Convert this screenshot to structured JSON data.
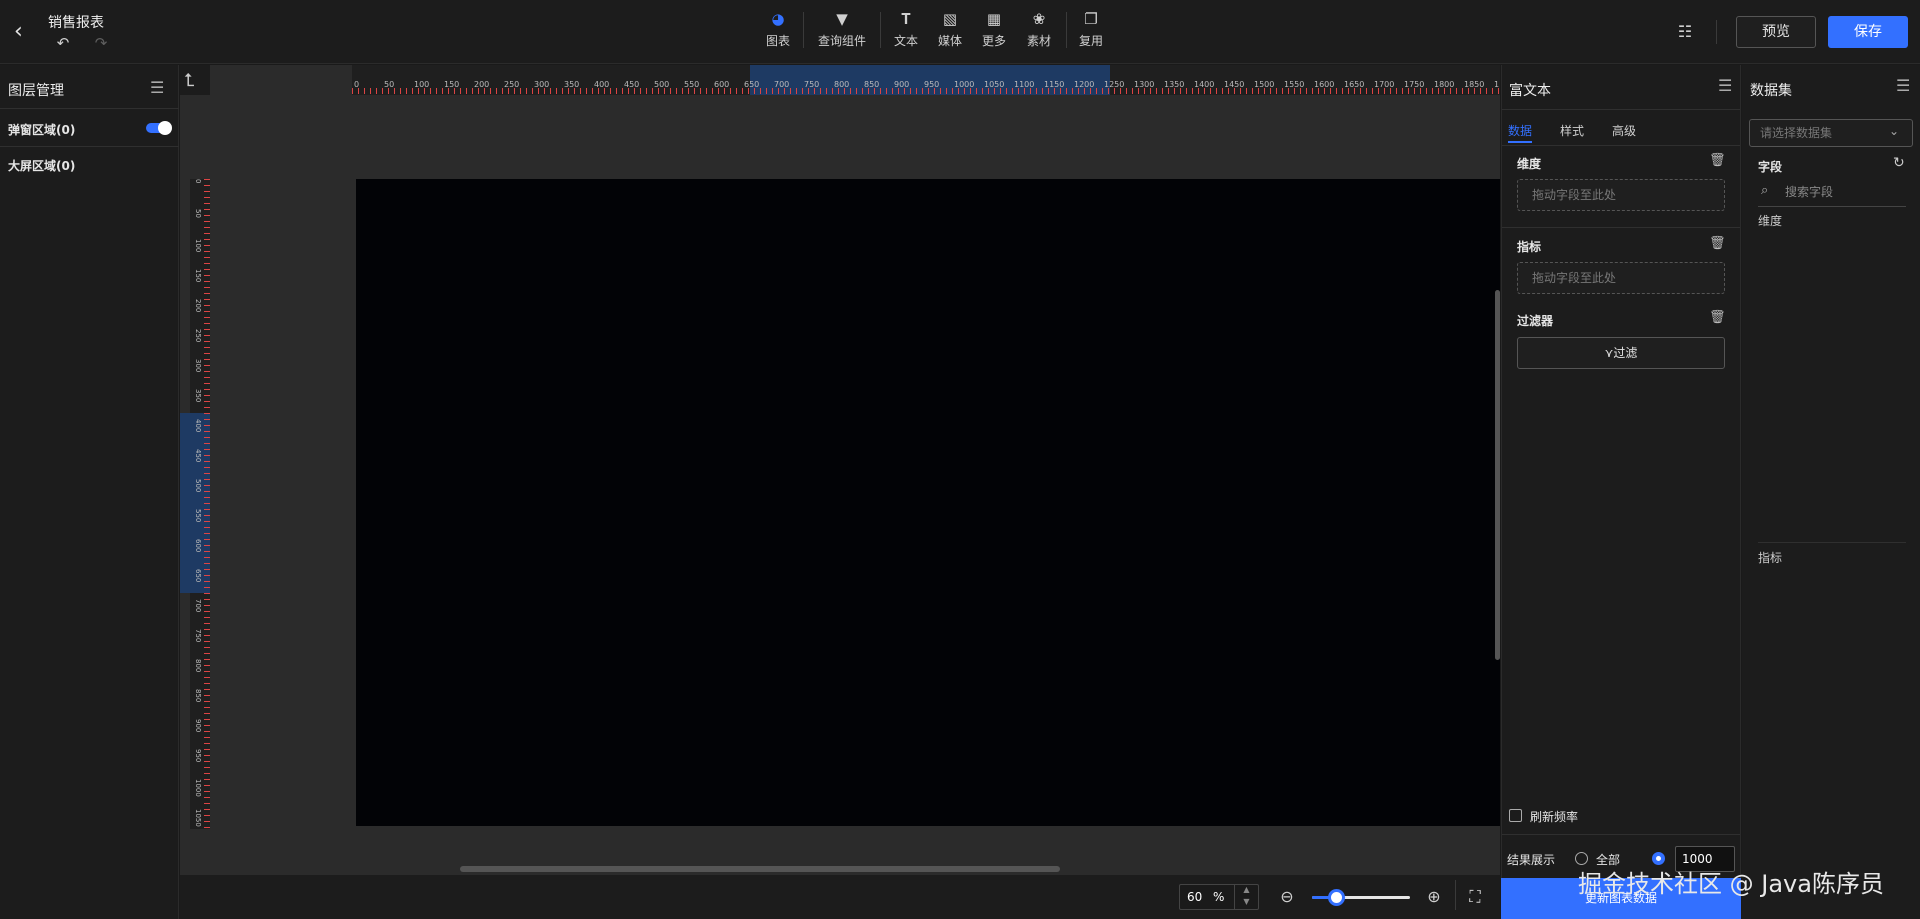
{
  "header": {
    "title": "销售报表",
    "toolbar": [
      {
        "name": "chart",
        "label": "图表",
        "icon": "pie-chart-icon"
      },
      {
        "name": "query",
        "label": "查询组件",
        "icon": "funnel-icon"
      },
      {
        "name": "text",
        "label": "文本",
        "icon": "text-box-icon"
      },
      {
        "name": "media",
        "label": "媒体",
        "icon": "image-icon"
      },
      {
        "name": "more",
        "label": "更多",
        "icon": "grid-icon"
      },
      {
        "name": "material",
        "label": "素材",
        "icon": "palette-icon"
      },
      {
        "name": "reuse",
        "label": "复用",
        "icon": "copy-icon"
      }
    ],
    "preview_label": "预览",
    "save_label": "保存"
  },
  "layers": {
    "title": "图层管理",
    "popup_area": "弹窗区域(0)",
    "popup_toggle_on": true,
    "screen_area": "大屏区域(0)"
  },
  "canvas": {
    "ruler_h_labels": [
      "0",
      "50",
      "100",
      "150",
      "200",
      "250",
      "300",
      "350",
      "400",
      "450",
      "500",
      "550",
      "600",
      "650",
      "700",
      "750",
      "800",
      "850",
      "900",
      "950",
      "1000",
      "1050",
      "1100",
      "1150",
      "1200",
      "1250",
      "1300",
      "1350",
      "1400",
      "1450",
      "1500",
      "1550",
      "1600",
      "1650",
      "1700",
      "1750",
      "1800",
      "1850",
      "1"
    ],
    "ruler_v_labels": [
      "0",
      "50",
      "100",
      "150",
      "200",
      "250",
      "300",
      "350",
      "400",
      "450",
      "500",
      "550",
      "600",
      "650",
      "700",
      "750",
      "800",
      "850",
      "900",
      "950",
      "1000",
      "1050"
    ],
    "zoom_value": "60",
    "zoom_unit": "%",
    "zoom_slider_fraction": 0.24
  },
  "props": {
    "title": "富文本",
    "tabs": [
      "数据",
      "样式",
      "高级"
    ],
    "active_tab": 0,
    "dimension_label": "维度",
    "dimension_placeholder": "拖动字段至此处",
    "metric_label": "指标",
    "metric_placeholder": "拖动字段至此处",
    "filter_label": "过滤器",
    "filter_button": "过滤",
    "refresh_label": "刷新频率",
    "result_label": "结果展示",
    "result_all": "全部",
    "result_count": "1000",
    "update_button": "更新图表数据"
  },
  "dataset": {
    "title": "数据集",
    "select_placeholder": "请选择数据集",
    "fields_label": "字段",
    "search_placeholder": "搜索字段",
    "dimension_label": "维度",
    "metric_label": "指标"
  },
  "watermark": "掘金技术社区 @ Java陈序员",
  "colors": {
    "accent": "#3370ff",
    "canvas": "#020306",
    "panel": "#1c1c1c"
  }
}
